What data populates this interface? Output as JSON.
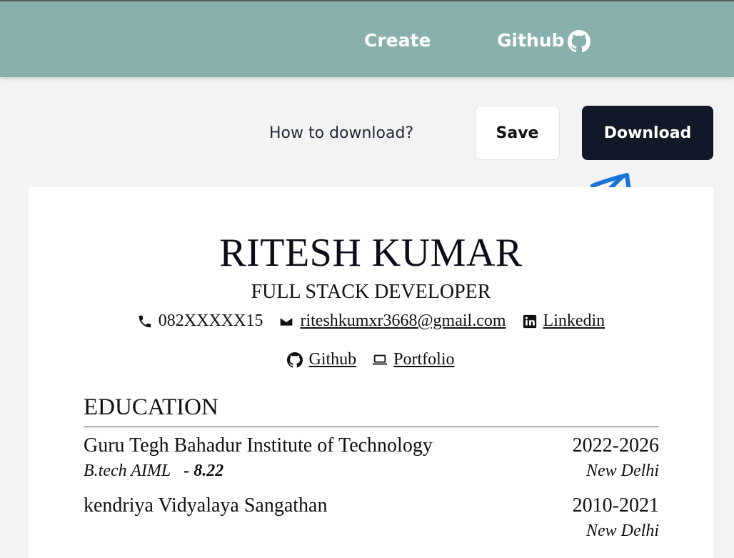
{
  "nav": {
    "create_label": "Create",
    "github_label": "Github"
  },
  "toolbar": {
    "how_to_label": "How to download?",
    "save_label": "Save",
    "download_label": "Download"
  },
  "resume": {
    "name": "RITESH KUMAR",
    "role": "FULL STACK DEVELOPER",
    "contact": {
      "phone": "082XXXXX15",
      "email": "riteshkumxr3668@gmail.com",
      "linkedin": "Linkedin",
      "github": "Github",
      "portfolio": "Portfolio"
    },
    "education": {
      "title": "EDUCATION",
      "items": [
        {
          "school": "Guru Tegh Bahadur Institute of Technology",
          "years": "2022-2026",
          "degree": "B.tech AIML",
          "grade": "- 8.22",
          "location": "New Delhi"
        },
        {
          "school": "kendriya Vidyalaya Sangathan",
          "years": "2010-2021",
          "degree": "",
          "grade": "",
          "location": "New Delhi"
        }
      ]
    }
  },
  "colors": {
    "navbar": "#88b0ac",
    "download_button": "#111827",
    "arrow": "#1a73d9",
    "page_bg": "#f3f3f3"
  }
}
